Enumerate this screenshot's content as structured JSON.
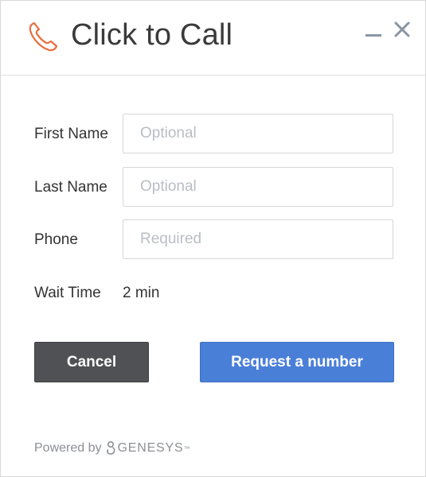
{
  "header": {
    "title": "Click to Call",
    "icon": "phone-icon",
    "accent_color": "#e86d3c",
    "minimize_icon": "minimize-icon",
    "close_icon": "close-icon"
  },
  "form": {
    "first_name": {
      "label": "First Name",
      "placeholder": "Optional",
      "value": ""
    },
    "last_name": {
      "label": "Last Name",
      "placeholder": "Optional",
      "value": ""
    },
    "phone": {
      "label": "Phone",
      "placeholder": "Required",
      "value": ""
    },
    "wait_time": {
      "label": "Wait Time",
      "value": "2 min"
    }
  },
  "buttons": {
    "cancel_label": "Cancel",
    "cancel_color": "#4f5154",
    "request_label": "Request a number",
    "request_color": "#4a7fd8"
  },
  "footer": {
    "powered_by": "Powered by",
    "brand": "GENESYS",
    "trademark": "™",
    "logo_icon": "genesys-logo-icon"
  }
}
